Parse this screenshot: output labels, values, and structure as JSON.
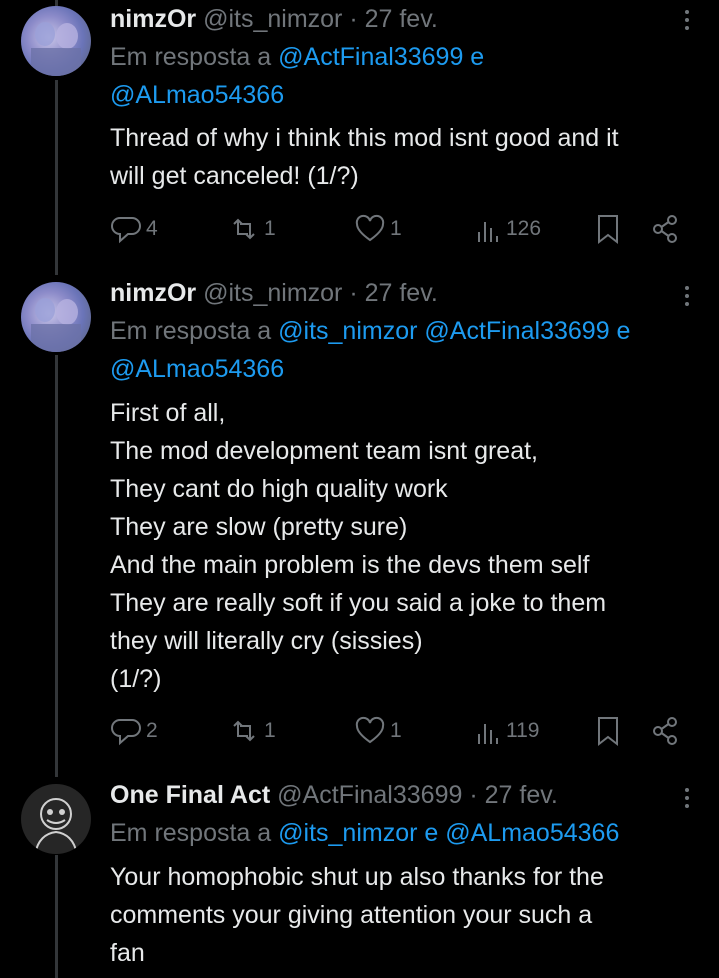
{
  "tweets": [
    {
      "name": "nimzOr",
      "handle": "@its_nimzor",
      "date": "· 27 fev.",
      "reply_prefix": "Em resposta a ",
      "mentions": [
        "@ActFinal33699",
        "@ALmao54366"
      ],
      "conjunction": " e ",
      "body": [
        "Thread of why i think this mod isnt good and it",
        "will get canceled! (1/?)"
      ],
      "replies": "4",
      "reposts": "1",
      "likes": "1",
      "views": "126"
    },
    {
      "name": "nimzOr",
      "handle": "@its_nimzor",
      "date": "· 27 fev.",
      "reply_prefix": "Em resposta a ",
      "mentions": [
        "@its_nimzor",
        "@ActFinal33699",
        "@ALmao54366"
      ],
      "conjunction": " e ",
      "body": [
        "First of all,",
        "The mod development team isnt great,",
        "They cant do high quality work",
        "They are slow (pretty sure)",
        "And the main problem is the devs them self",
        "They are really soft if you said a joke to them",
        "they will literally cry (sissies)",
        "(1/?)"
      ],
      "replies": "2",
      "reposts": "1",
      "likes": "1",
      "views": "119"
    },
    {
      "name": "One Final Act",
      "handle": "@ActFinal33699",
      "date": "· 27 fev.",
      "reply_prefix": "Em resposta a ",
      "mentions": [
        "@its_nimzor",
        "@ALmao54366"
      ],
      "conjunction": " e ",
      "body": [
        "Your homophobic shut up also thanks for the",
        "comments your giving attention your such a",
        "fan"
      ]
    }
  ],
  "icons": {
    "reply": "reply-icon",
    "repost": "repost-icon",
    "like": "heart-icon",
    "views": "views-icon",
    "bookmark": "bookmark-icon",
    "share": "share-icon",
    "more": "more-icon"
  },
  "colors": {
    "background": "#000000",
    "text": "#e7e9ea",
    "muted": "#71767b",
    "link": "#1d9bf0"
  }
}
